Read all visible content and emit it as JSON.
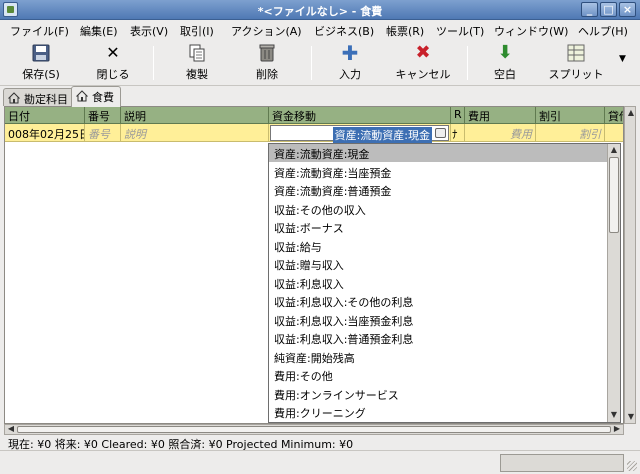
{
  "window": {
    "title": "*<ファイルなし> - 食費",
    "minimize": "_",
    "maximize": "□",
    "close": "×"
  },
  "menu": [
    "ファイル(F)",
    "編集(E)",
    "表示(V)",
    "取引(I)",
    "アクション(A)",
    "ビジネス(B)",
    "帳票(R)",
    "ツール(T)",
    "ウィンドウ(W)",
    "ヘルプ(H)"
  ],
  "toolbar": {
    "save": "保存(S)",
    "close": "閉じる",
    "duplicate": "複製",
    "delete": "削除",
    "enter": "入力",
    "cancel": "キャンセル",
    "blank": "空白",
    "split": "スプリット"
  },
  "tabs": [
    {
      "label": "勘定科目",
      "active": false
    },
    {
      "label": "食費",
      "active": true
    }
  ],
  "register": {
    "headers": {
      "date": "日付",
      "num": "番号",
      "description": "説明",
      "transfer": "資金移動",
      "reconcile": "R",
      "expense": "費用",
      "rebate": "割引",
      "balance": "貸借"
    },
    "entry": {
      "date": "008年02月25日",
      "num": "番号",
      "description": "説明",
      "transfer": "資産:流動資産:現金",
      "reconcile": "ﾅ",
      "expense": "費用",
      "rebate": "割引"
    }
  },
  "account_popup": [
    "資産:流動資産:現金",
    "資産:流動資産:当座預金",
    "資産:流動資産:普通預金",
    "収益:その他の収入",
    "収益:ボーナス",
    "収益:給与",
    "収益:贈与収入",
    "収益:利息収入",
    "収益:利息収入:その他の利息",
    "収益:利息収入:当座預金利息",
    "収益:利息収入:普通預金利息",
    "純資産:開始残高",
    "費用:その他",
    "費用:オンラインサービス",
    "費用:クリーニング"
  ],
  "summary": "現在: ¥0   将来: ¥0   Cleared: ¥0   照合済: ¥0   Projected Minimum: ¥0"
}
